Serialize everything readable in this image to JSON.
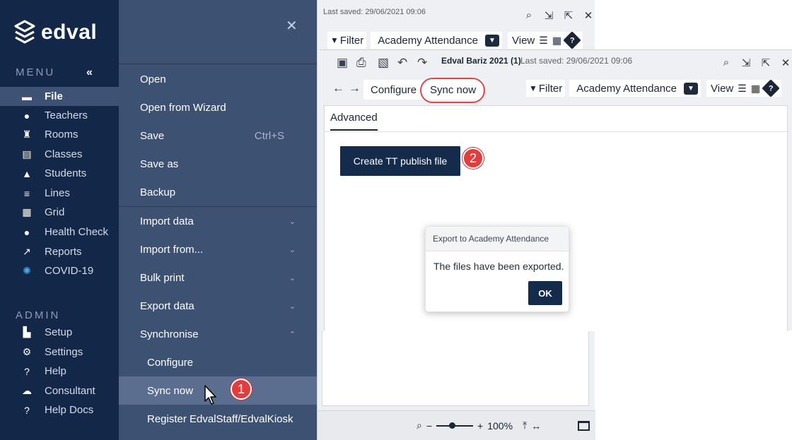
{
  "sidebar": {
    "brand": "edval",
    "menu_label": "MENU",
    "collapse_glyph": "«",
    "items": [
      {
        "label": "File",
        "icon": "folder-icon",
        "glyph": "▬"
      },
      {
        "label": "Teachers",
        "icon": "person-icon",
        "glyph": "●"
      },
      {
        "label": "Rooms",
        "icon": "chair-icon",
        "glyph": "♜"
      },
      {
        "label": "Classes",
        "icon": "book-icon",
        "glyph": "▤"
      },
      {
        "label": "Students",
        "icon": "graduation-cap-icon",
        "glyph": "▲"
      },
      {
        "label": "Lines",
        "icon": "lines-icon",
        "glyph": "≡"
      },
      {
        "label": "Grid",
        "icon": "grid-icon",
        "glyph": "▦"
      },
      {
        "label": "Health Check",
        "icon": "apple-icon",
        "glyph": "●"
      },
      {
        "label": "Reports",
        "icon": "trend-icon",
        "glyph": "↗"
      },
      {
        "label": "COVID-19",
        "icon": "virus-icon",
        "glyph": "✺"
      }
    ],
    "admin_label": "ADMIN",
    "admin_items": [
      {
        "label": "Setup",
        "icon": "building-icon",
        "glyph": "▙"
      },
      {
        "label": "Settings",
        "icon": "gear-icon",
        "glyph": "⚙"
      },
      {
        "label": "Help",
        "icon": "help-bubble-icon",
        "glyph": "?"
      },
      {
        "label": "Consultant",
        "icon": "brain-icon",
        "glyph": "☁"
      },
      {
        "label": "Help Docs",
        "icon": "help-docs-icon",
        "glyph": "?"
      }
    ]
  },
  "file_menu": {
    "close_glyph": "✕",
    "items": [
      {
        "label": "Open"
      },
      {
        "label": "Open from Wizard"
      },
      {
        "label": "Save",
        "shortcut": "Ctrl+S"
      },
      {
        "label": "Save as"
      },
      {
        "label": "Backup"
      },
      {
        "label": "Import data",
        "chevron": "⌄"
      },
      {
        "label": "Import from...",
        "chevron": "⌄"
      },
      {
        "label": "Bulk print",
        "chevron": "⌄"
      },
      {
        "label": "Export data",
        "chevron": "⌄"
      },
      {
        "label": "Synchronise",
        "chevron": "⌃"
      },
      {
        "label": "Configure"
      },
      {
        "label": "Sync now"
      },
      {
        "label": "Register EdvalStaff/EdvalKiosk"
      }
    ]
  },
  "markers": {
    "one": "1",
    "two": "2"
  },
  "back_window": {
    "last_saved": "Last saved: 29/06/2021 09:06",
    "filter_label": "Filter",
    "filter_value": "Academy Attendance",
    "view_label": "View"
  },
  "front_window": {
    "title": "Edval Bariz 2021 (1)",
    "last_saved": "Last saved: 29/06/2021 09:06",
    "tabs": [
      "Configure",
      "Sync now"
    ],
    "filter_label": "Filter",
    "filter_value": "Academy Attendance",
    "view_label": "View",
    "sub_tab": "Advanced",
    "primary_button": "Create TT publish file",
    "dialog": {
      "title": "Export to Academy Attendance",
      "message": "The files have been exported.",
      "ok": "OK"
    }
  },
  "status_bar": {
    "zoom": "100%"
  },
  "colors": {
    "sidebar": "#132849",
    "menu_panel": "#3d5173",
    "primary": "#152b4c",
    "marker": "#e23c3c"
  }
}
